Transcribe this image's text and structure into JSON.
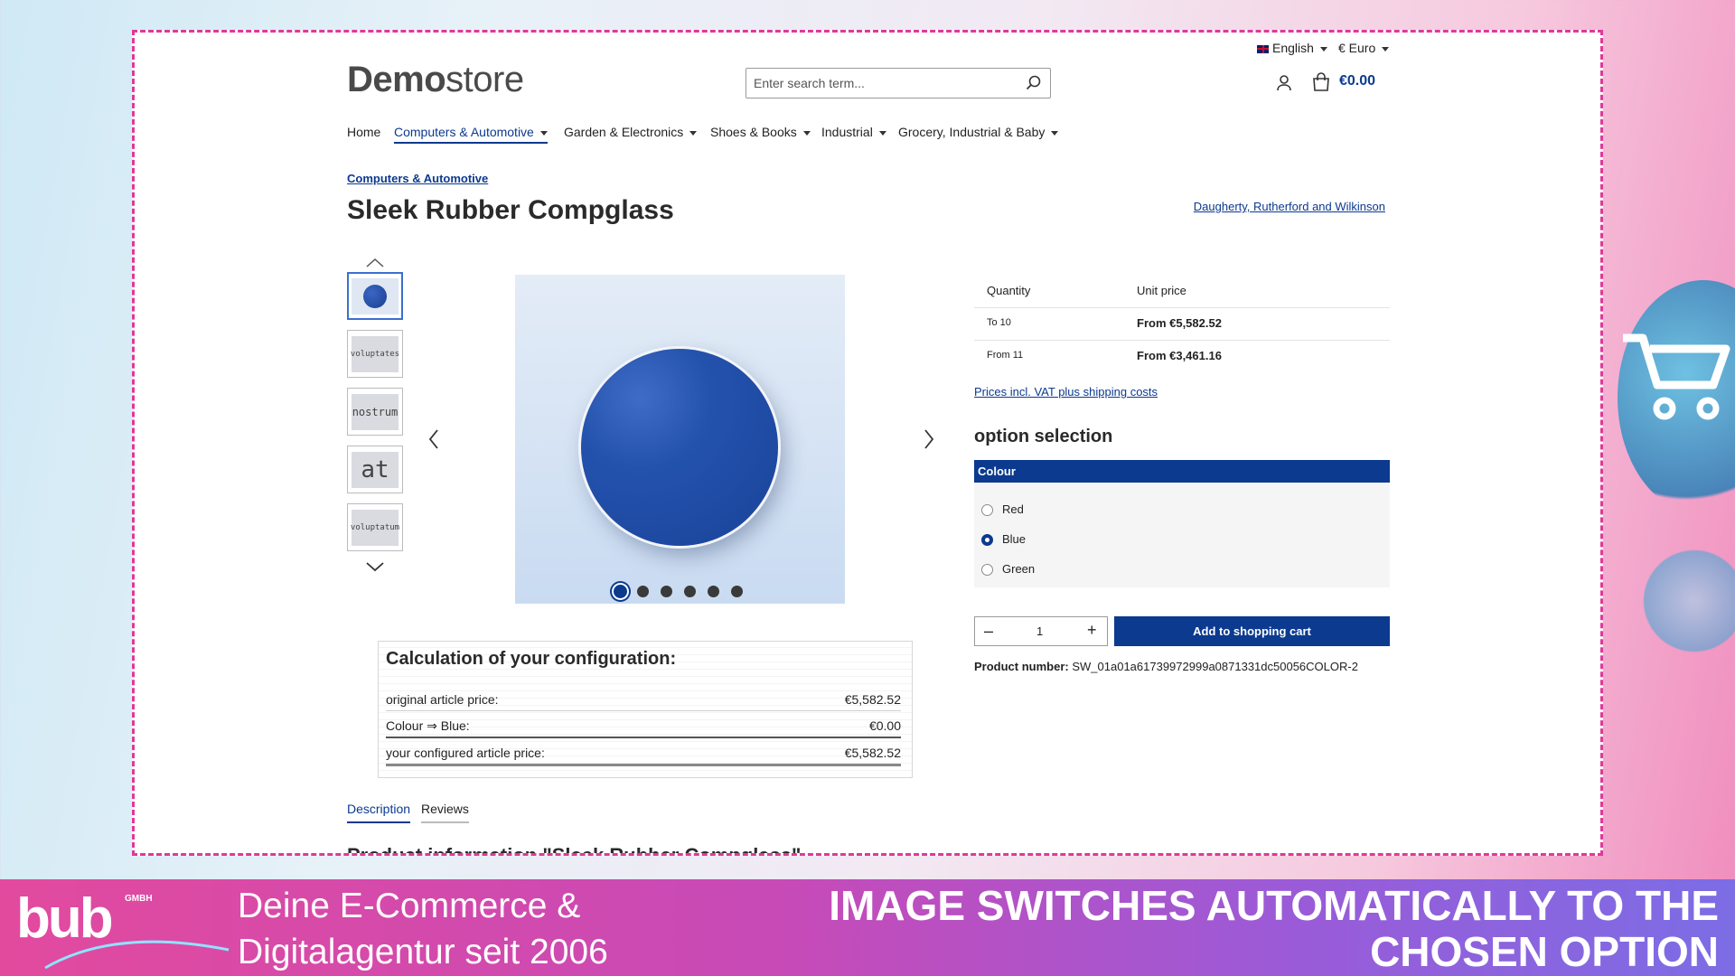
{
  "topbar": {
    "language": "English",
    "currency": "€ Euro"
  },
  "header": {
    "logo_bold": "Demo",
    "logo_light": "store",
    "search_placeholder": "Enter search term...",
    "cart_total": "€0.00"
  },
  "nav": {
    "items": [
      {
        "label": "Home"
      },
      {
        "label": "Computers & Automotive"
      },
      {
        "label": "Garden & Electronics"
      },
      {
        "label": "Shoes & Books"
      },
      {
        "label": "Industrial"
      },
      {
        "label": "Grocery, Industrial & Baby"
      }
    ]
  },
  "product": {
    "breadcrumb": "Computers & Automotive",
    "title": "Sleek Rubber Compglass",
    "manufacturer": "Daugherty, Rutherford and Wilkinson",
    "thumbnails": [
      "",
      "voluptates",
      "nostrum",
      "at",
      "voluptatum"
    ],
    "gallery_dot_count": 6,
    "selected_dot": 0
  },
  "pricing": {
    "col_quantity": "Quantity",
    "col_unit_price": "Unit price",
    "rows": [
      {
        "qty": "To 10",
        "price": "From €5,582.52"
      },
      {
        "qty": "From 11",
        "price": "From €3,461.16"
      }
    ],
    "vat_link": "Prices incl. VAT plus shipping costs"
  },
  "options": {
    "heading": "option selection",
    "group_label": "Colour",
    "choices": [
      {
        "label": "Red",
        "selected": false
      },
      {
        "label": "Blue",
        "selected": true
      },
      {
        "label": "Green",
        "selected": false
      }
    ]
  },
  "buy": {
    "minus": "–",
    "quantity": "1",
    "plus": "+",
    "add_to_cart": "Add to shopping cart",
    "product_number_label": "Product number:",
    "product_number": "SW_01a01a61739972999a0871331dc50056COLOR-2"
  },
  "calculation": {
    "title": "Calculation of your configuration:",
    "rows": [
      {
        "label": "original article price:",
        "value": "€5,582.52"
      },
      {
        "label": "Colour ⇒ Blue:",
        "value": "€0.00"
      },
      {
        "label": "your configured article price:",
        "value": "€5,582.52"
      }
    ]
  },
  "tabs": {
    "description": "Description",
    "reviews": "Reviews"
  },
  "product_info_heading": "Product information \"Sleek Rubber Compglass\"",
  "footer": {
    "logo_text": "bub",
    "logo_badge": "GMBH",
    "tagline_line1": "Deine E-Commerce &",
    "tagline_line2": "Digitalagentur seit 2006",
    "headline_line1": "IMAGE SWITCHES AUTOMATICALLY TO THE",
    "headline_line2": "CHOSEN OPTION"
  },
  "colors": {
    "accent": "#0b3a8f",
    "frame": "#e0389a",
    "product_ball": "#1f4fa6"
  }
}
